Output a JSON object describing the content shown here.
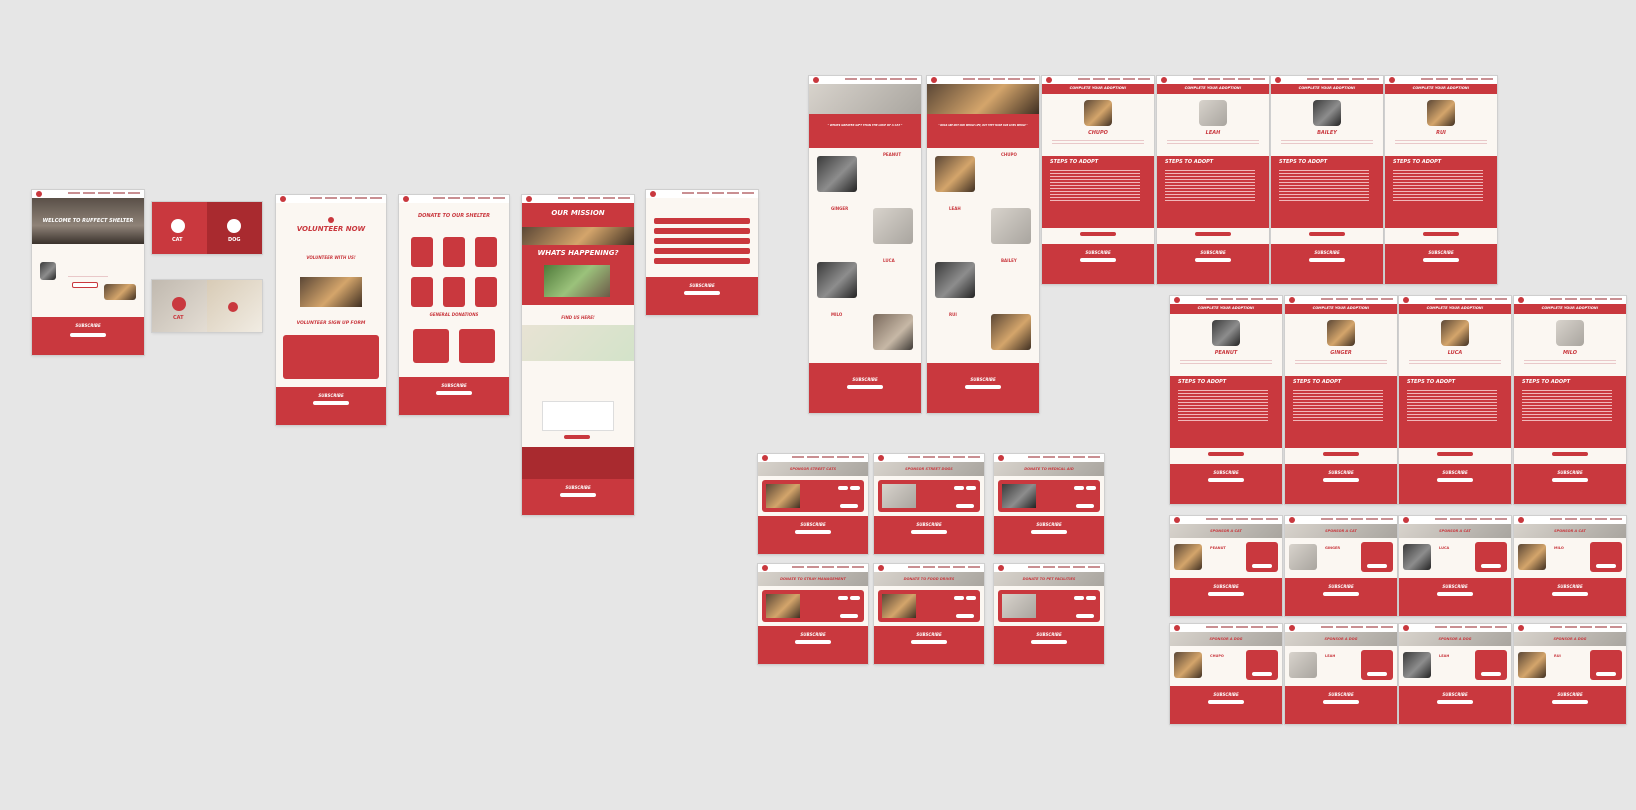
{
  "canvas": {
    "background": "#e6e6e6"
  },
  "colors": {
    "accent": "#c9383e",
    "accent_dark": "#a92a2f",
    "page_bg": "#fbf7f2"
  },
  "frame_menu_icon": "more-horizontal-icon",
  "frames": {
    "home": {
      "hero_title": "WELCOME TO RUFFECT SHELTER",
      "subscribe": "SUBSCRIBE"
    },
    "choose_cat": {
      "label": "CAT"
    },
    "choose_dog": {
      "label": "DOG"
    },
    "choose_cat2": {
      "label": "CAT"
    },
    "volunteer": {
      "title": "VOLUNTEER NOW",
      "subtitle": "VOLUNTEER WITH US!",
      "form_title": "VOLUNTEER SIGN UP FORM",
      "subscribe": "SUBSCRIBE"
    },
    "donate": {
      "title": "DONATE TO OUR SHELTER",
      "general": "GENERAL DONATIONS",
      "subscribe": "SUBSCRIBE"
    },
    "mission": {
      "title": "OUR MISSION",
      "happening": "WHATS HAPPENING?",
      "find": "FIND US HERE!",
      "subscribe": "SUBSCRIBE"
    },
    "faq": {
      "subscribe": "SUBSCRIBE"
    },
    "cats_list": {
      "quote": "\" WHATS GREATER GIFT THAN THE LOVE OF A CAT \"",
      "pets": [
        "PEANUT",
        "GINGER",
        "LUCA",
        "MILO"
      ],
      "subscribe": "SUBSCRIBE"
    },
    "dogs_list": {
      "quote": "\" DOGS ARE NOT OUR WHOLE LIFE, BUT THEY MAKE OUR LIVES WHOLE \"",
      "pets": [
        "CHUPO",
        "LEAH",
        "BAILEY",
        "RUI"
      ],
      "subscribe": "SUBSCRIBE"
    },
    "adopt_complete": {
      "header": "COMPLETE YOUR ADOPTION!",
      "steps": "STEPS TO ADOPT",
      "subscribe": "SUBSCRIBE",
      "pets_row1": [
        "CHUPO",
        "LEAH",
        "BAILEY",
        "RUI"
      ],
      "pets_row2": [
        "PEANUT",
        "GINGER",
        "LUCA",
        "MILO"
      ]
    },
    "sponsor_donate": {
      "titles": [
        "SPONSOR STREET CATS",
        "SPONSOR STREET DOGS",
        "DONATE TO MEDICAL AID",
        "DONATE TO STRAY MANAGEMENT",
        "DONATE TO FOOD DRIVES",
        "DONATE TO PET FACILITIES"
      ],
      "subscribe": "SUBSCRIBE"
    },
    "sponsor_cat": {
      "title": "SPONSOR A CAT",
      "pets": [
        "PEANUT",
        "GINGER",
        "LUCA",
        "MILO"
      ],
      "subscribe": "SUBSCRIBE"
    },
    "sponsor_dog": {
      "title": "SPONSOR A DOG",
      "pets": [
        "CHUPO",
        "LEAH",
        "LEAH",
        "RUI"
      ],
      "subscribe": "SUBSCRIBE"
    }
  }
}
